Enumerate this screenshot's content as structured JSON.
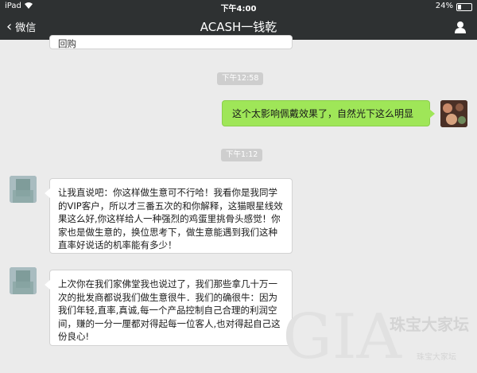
{
  "status_bar": {
    "device": "iPad",
    "wifi_icon": "wifi-icon",
    "time": "下午4:00",
    "battery_percent": "24%",
    "battery_level": 0.24
  },
  "nav": {
    "back_label": "微信",
    "title": "ACASH一钱乾",
    "profile_icon": "person-icon"
  },
  "messages": {
    "partial_top": "回购",
    "time_1": "下午12:58",
    "sent_1": "这个太影响佩戴效果了，自然光下这么明显",
    "time_2": "下午1:12",
    "received_1": "让我直说吧：你这样做生意可不行哈！我看你是我同学的VIP客户，所以才三番五次的和你解释，这猫眼星线效果这么好,你这样给人一种强烈的鸡蛋里挑骨头感觉！你家也是做生意的，换位思考下，做生意能遇到我们这种直率好说话的机率能有多少！",
    "received_2": "上次你在我们家佛堂我也说过了，我们那些拿几十万一次的批发商都说我们做生意很牛．我们的确很牛：因为我们年轻,直率,真诚,每一个产品控制自己合理的利润空间，赚的一分一厘都对得起每一位客人,也对得起自己这份良心!"
  },
  "watermark": {
    "letters": "GIA",
    "name": "珠宝大家坛",
    "small": "珠宝大家坛"
  }
}
